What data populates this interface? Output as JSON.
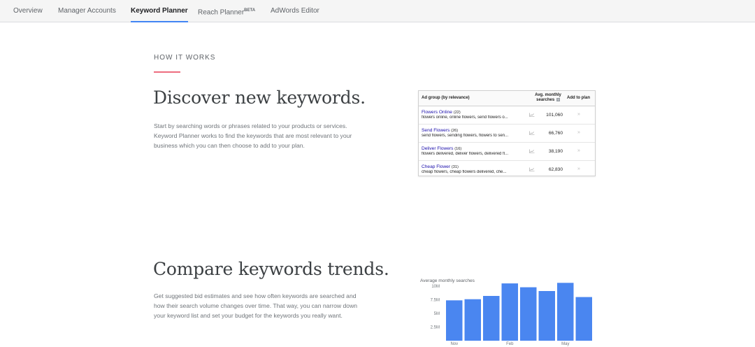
{
  "nav": {
    "tabs": [
      {
        "label": "Overview"
      },
      {
        "label": "Manager Accounts"
      },
      {
        "label": "Keyword Planner"
      },
      {
        "label": "Reach Planner",
        "badge": "BETA"
      },
      {
        "label": "AdWords Editor"
      }
    ],
    "active": "Keyword Planner"
  },
  "how_it_works": "HOW IT WORKS",
  "section1": {
    "title": "Discover new keywords.",
    "body": "Start by searching words or phrases related to your products or services. Keyword Planner works to find the keywords that are most relevant to your business which you can then choose to add to your plan."
  },
  "kw_table": {
    "headers": {
      "group": "Ad group (by relevance)",
      "searches": "Avg. monthly searches",
      "help": "?",
      "add": "Add to plan"
    },
    "rows": [
      {
        "name": "Flowers Online",
        "count": "(22)",
        "keywords": "flowers online, online flowers, send flowers o...",
        "value": "101,060",
        "add": "»"
      },
      {
        "name": "Send Flowers",
        "count": "(26)",
        "keywords": "send flowers, sending flowers, flowers to sen...",
        "value": "66,760",
        "add": "»"
      },
      {
        "name": "Deliver Flowers",
        "count": "(16)",
        "keywords": "flowers delivered, deliver flowers, delivered fl...",
        "value": "38,190",
        "add": "»"
      },
      {
        "name": "Cheap Flower",
        "count": "(31)",
        "keywords": "cheap flowers, cheap flowers delivered, che...",
        "value": "62,830",
        "add": "»"
      }
    ]
  },
  "section2": {
    "title": "Compare keywords trends.",
    "body": "Get suggested bid estimates and see how often keywords are searched and how their search volume changes over time. That way, you can narrow down your keyword list and set your budget for the keywords you really want."
  },
  "colors": {
    "accent": "#4285f4",
    "eyebrow_rule": "#ee6d7f",
    "link": "#1a0dab",
    "bar": "#4a86f0"
  },
  "chart_data": {
    "type": "bar",
    "title": "Average monthly searches",
    "values": [
      7.4,
      7.6,
      8.2,
      10.5,
      9.8,
      9.1,
      10.6,
      8.0
    ],
    "y_tick_labels": [
      "10M",
      "7.5M",
      "5M",
      "2.5M"
    ],
    "y_ticks": [
      10,
      7.5,
      5,
      2.5
    ],
    "x_tick_labels": [
      {
        "label": "Nov",
        "index": 0
      },
      {
        "label": "Feb",
        "index": 3
      },
      {
        "label": "May",
        "index": 6
      }
    ],
    "ylim": [
      0,
      12.5
    ],
    "grid": false
  }
}
